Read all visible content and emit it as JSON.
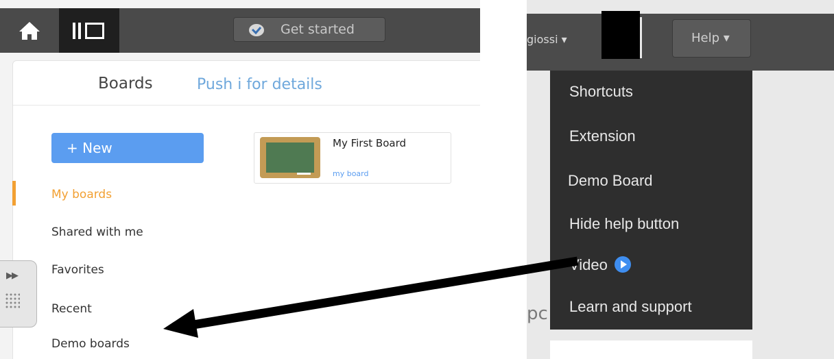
{
  "left_app": {
    "get_started_label": "Get started",
    "boards_title": "Boards",
    "boards_hint": "Push i for details",
    "new_button_label": "+ New",
    "nav": [
      {
        "label": "My boards",
        "active": true
      },
      {
        "label": "Shared with me",
        "active": false
      },
      {
        "label": "Favorites",
        "active": false
      },
      {
        "label": "Recent",
        "active": false
      },
      {
        "label": "Demo boards",
        "active": false
      }
    ],
    "board": {
      "name": "My First Board",
      "description": "my board"
    }
  },
  "right_app": {
    "username_fragment": "giossi ▾",
    "help_button_label": "Help ▾",
    "help_menu": [
      {
        "label": "Shortcuts"
      },
      {
        "label": "Extension"
      },
      {
        "label": "Demo Board"
      },
      {
        "label": "Hide help button"
      },
      {
        "label": "Video",
        "icon": "play-circle-icon"
      },
      {
        "label": "Learn and support"
      }
    ],
    "background_fragment": "pc"
  },
  "colors": {
    "accent_blue": "#5b9df0",
    "active_orange": "#f2a032",
    "toolbar_dark": "#4a4a4a",
    "menu_dark": "#2e2e2e"
  },
  "icons": [
    "home-icon",
    "boards-logo-icon",
    "checkmark-icon",
    "expand-arrows-icon",
    "keypad-grid-icon",
    "play-circle-icon",
    "pointer-arrow"
  ]
}
